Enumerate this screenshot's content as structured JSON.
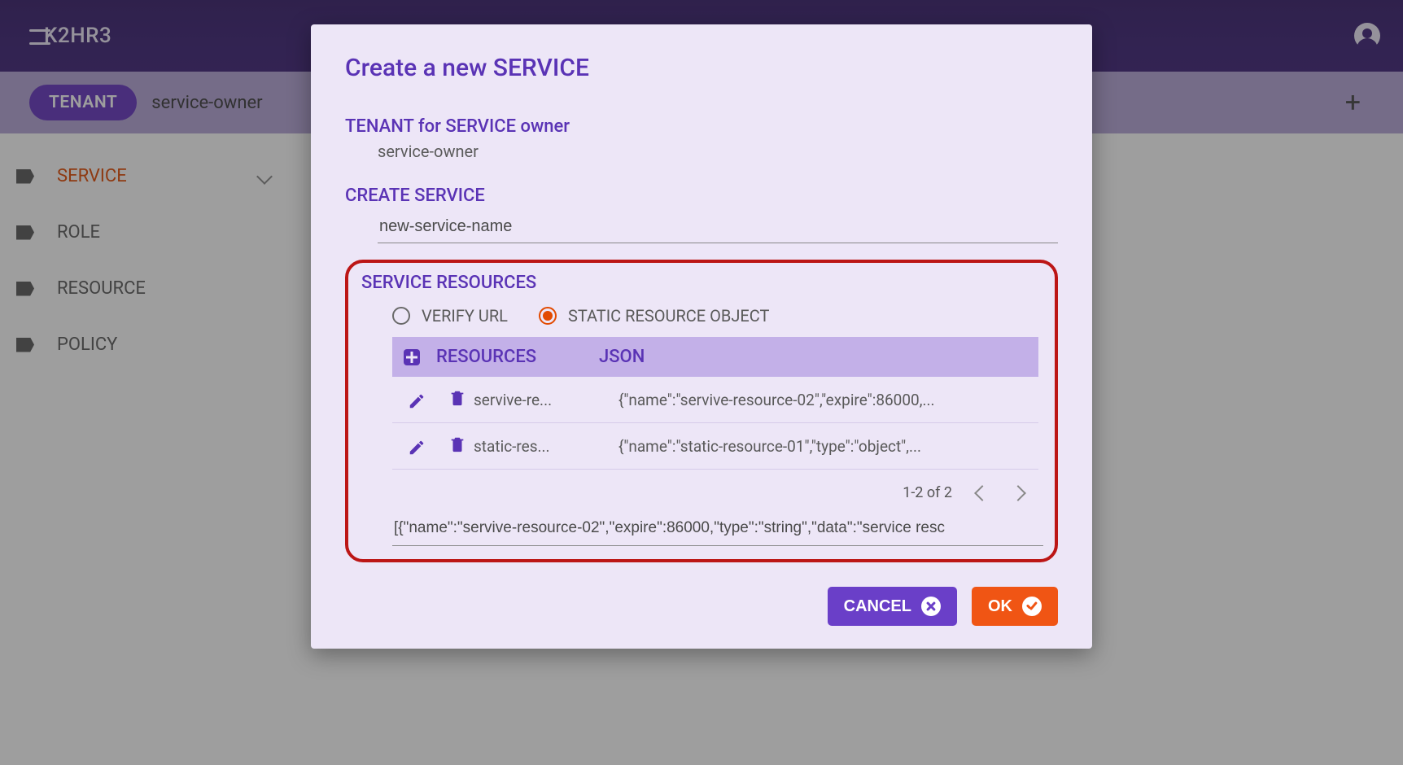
{
  "appbar": {
    "brand": "K2HR3"
  },
  "tenant": {
    "chip_label": "TENANT",
    "name": "service-owner"
  },
  "sidebar": {
    "items": [
      {
        "label": "SERVICE",
        "active": true,
        "expandable": true
      },
      {
        "label": "ROLE"
      },
      {
        "label": "RESOURCE"
      },
      {
        "label": "POLICY"
      }
    ]
  },
  "dialog": {
    "title": "Create a new SERVICE",
    "tenant_section": {
      "heading": "TENANT for SERVICE owner",
      "value": "service-owner"
    },
    "create_section": {
      "heading": "CREATE SERVICE",
      "value": "new-service-name"
    },
    "resources_section": {
      "heading": "SERVICE RESOURCES",
      "radio": {
        "verify_url": "VERIFY URL",
        "static_obj": "STATIC RESOURCE OBJECT",
        "selected": "static_obj"
      },
      "table": {
        "col_res": "RESOURCES",
        "col_json": "JSON",
        "rows": [
          {
            "name": "servive-re...",
            "json": "{\"name\":\"servive-resource-02\",\"expire\":86000,..."
          },
          {
            "name": "static-res...",
            "json": "{\"name\":\"static-resource-01\",\"type\":\"object\",..."
          }
        ],
        "pager": "1-2 of 2"
      },
      "jsonline": "[{\"name\":\"servive-resource-02\",\"expire\":86000,\"type\":\"string\",\"data\":\"service resc"
    },
    "buttons": {
      "cancel": "CANCEL",
      "ok": "OK"
    }
  }
}
